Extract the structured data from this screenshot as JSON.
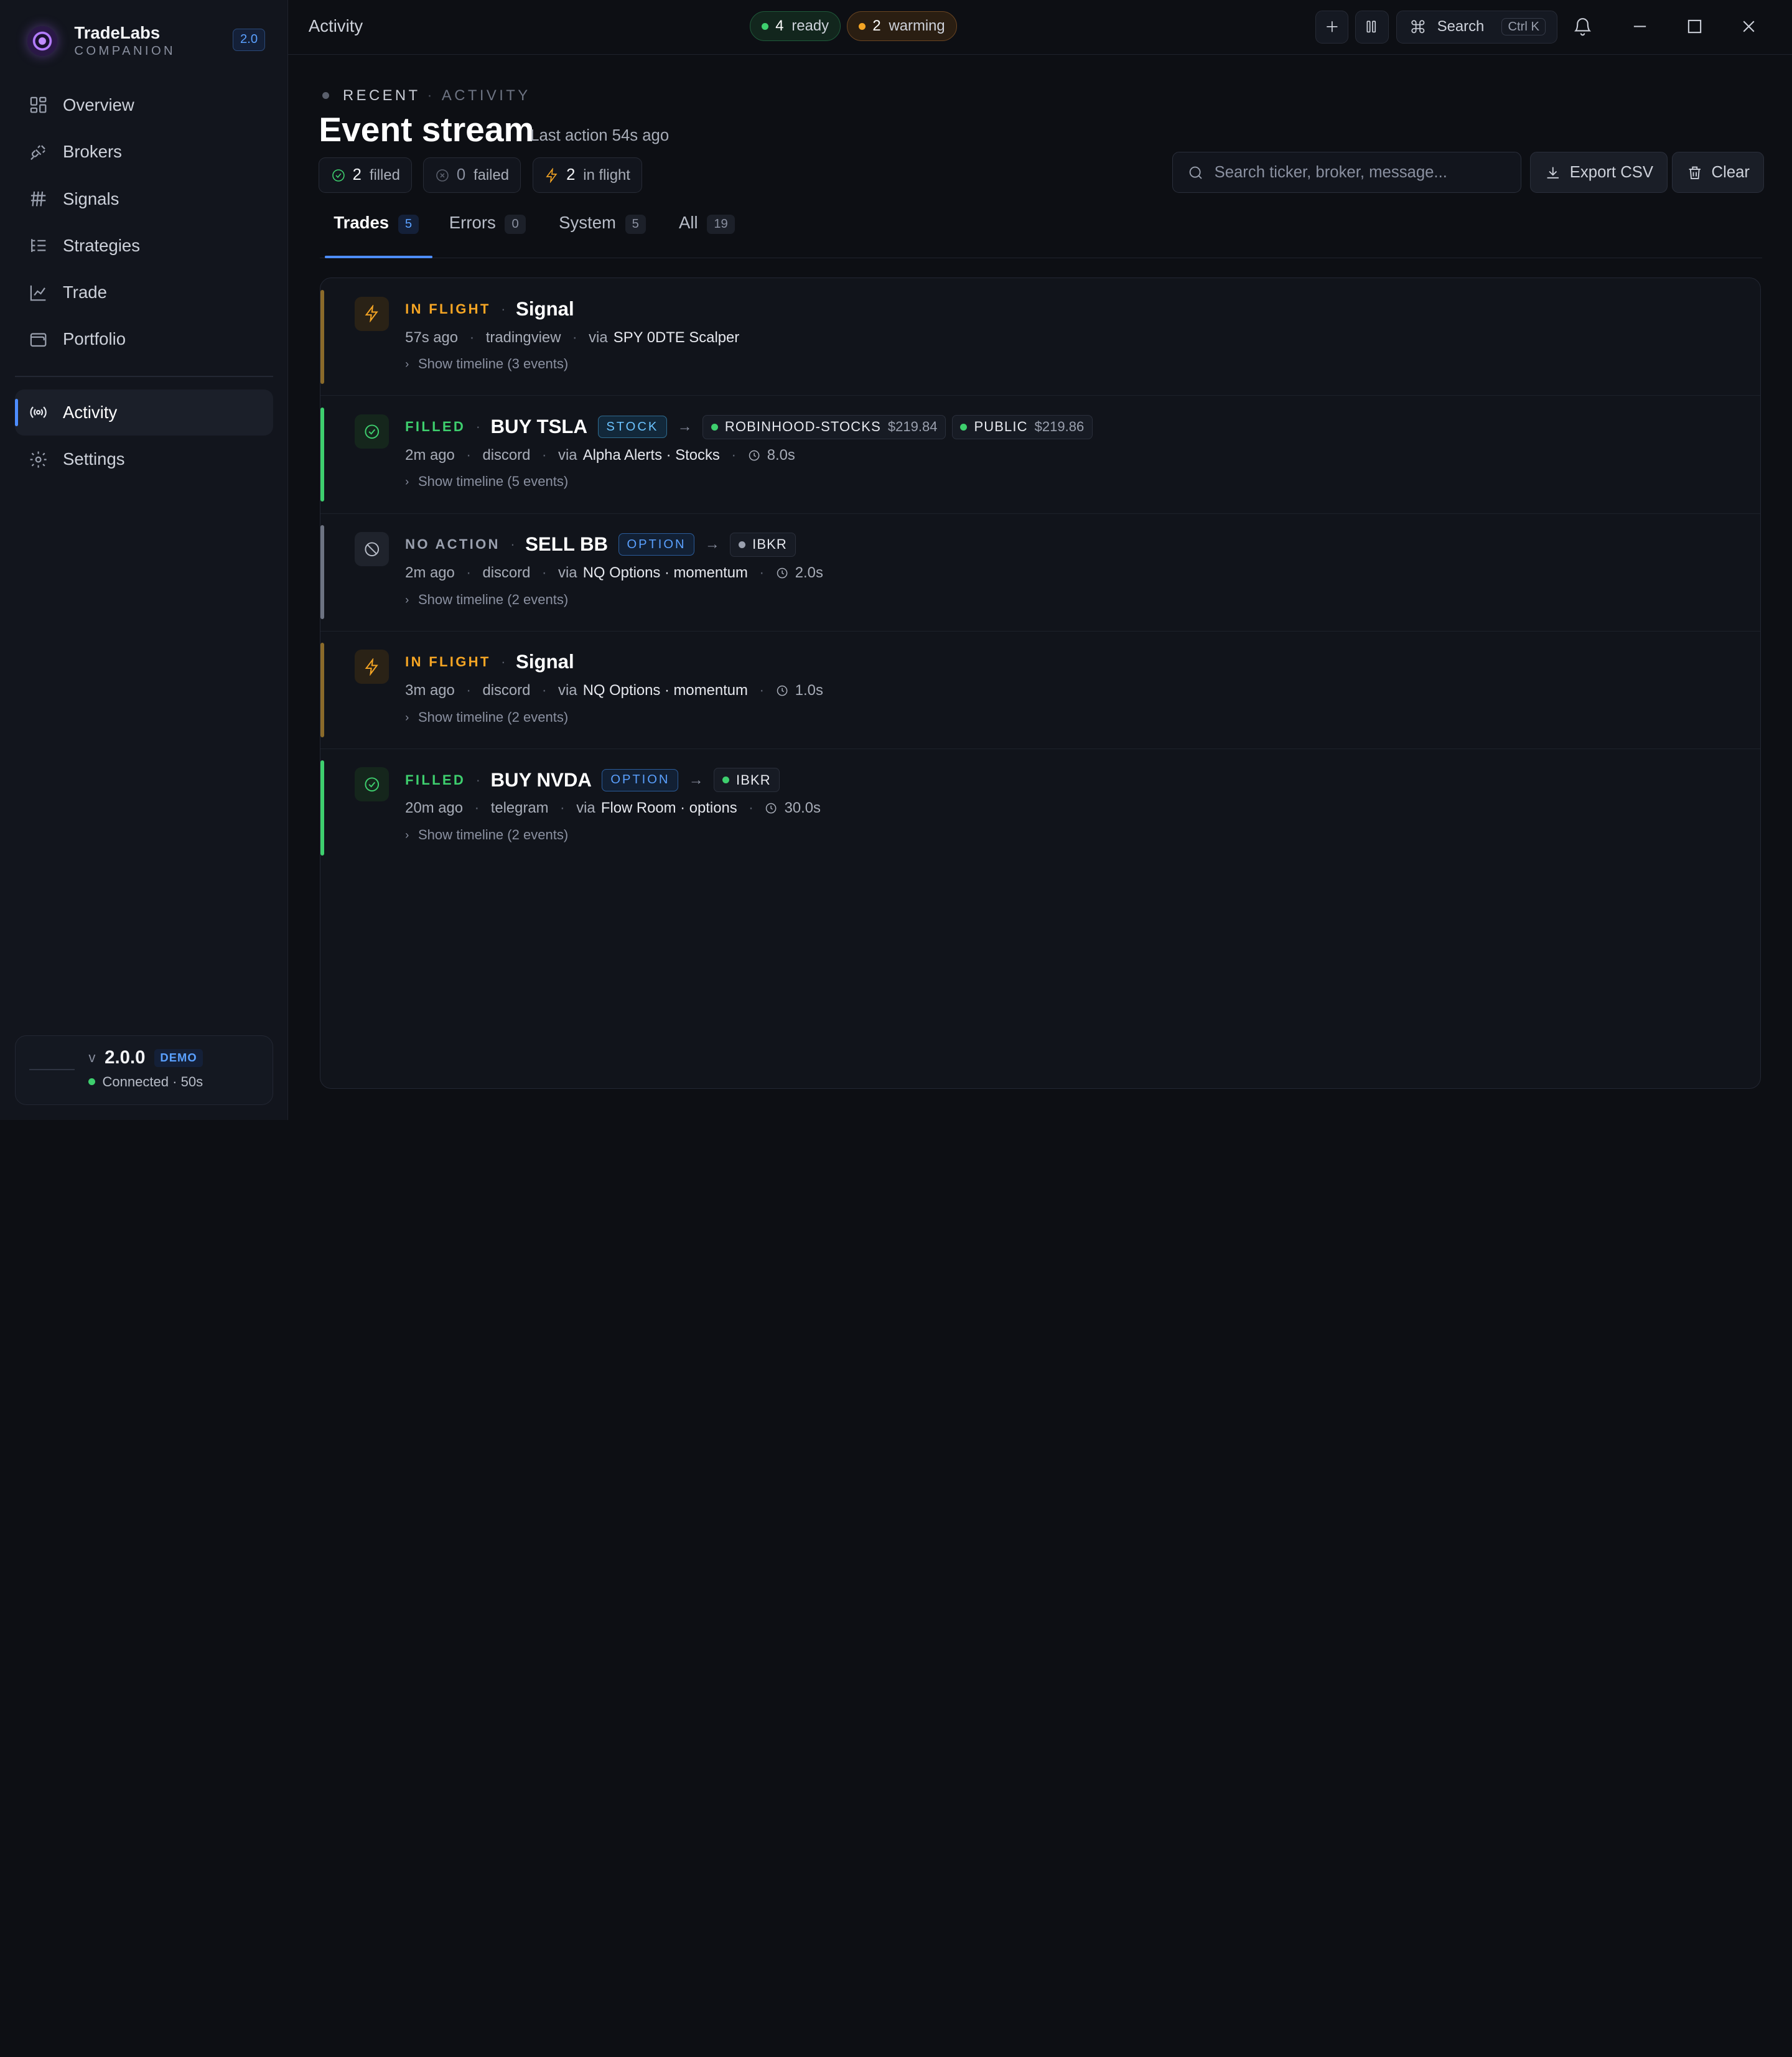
{
  "brand": {
    "name": "TradeLabs",
    "subtitle": "COMPANION",
    "version_badge": "2.0"
  },
  "nav": {
    "items": [
      {
        "label": "Overview",
        "icon": "grid-icon"
      },
      {
        "label": "Brokers",
        "icon": "plug-icon"
      },
      {
        "label": "Signals",
        "icon": "signal-icon"
      },
      {
        "label": "Strategies",
        "icon": "list-tree-icon"
      },
      {
        "label": "Trade",
        "icon": "line-chart-icon"
      },
      {
        "label": "Portfolio",
        "icon": "wallet-icon"
      }
    ],
    "bottom_items": [
      {
        "label": "Activity",
        "icon": "radio-broadcast-icon",
        "active": true
      },
      {
        "label": "Settings",
        "icon": "gear-icon"
      }
    ]
  },
  "status_card": {
    "prefix": "v",
    "version": "2.0.0",
    "badge": "DEMO",
    "connection": "Connected · 50s"
  },
  "topbar": {
    "title": "Activity",
    "ready_count": "4",
    "ready_label": "ready",
    "warming_count": "2",
    "warming_label": "warming",
    "search_label": "Search",
    "search_shortcut": "Ctrl K"
  },
  "header": {
    "crumb_primary": "RECENT",
    "crumb_secondary": "ACTIVITY",
    "title": "Event stream",
    "last_action": "Last action 54s ago"
  },
  "summary": {
    "filled_count": "2",
    "filled_label": "filled",
    "failed_count": "0",
    "failed_label": "failed",
    "inflight_count": "2",
    "inflight_label": "in flight"
  },
  "search": {
    "placeholder": "Search ticker, broker, message..."
  },
  "actions": {
    "export_label": "Export CSV",
    "clear_label": "Clear"
  },
  "tabs": [
    {
      "label": "Trades",
      "count": "5",
      "active": true
    },
    {
      "label": "Errors",
      "count": "0"
    },
    {
      "label": "System",
      "count": "5"
    },
    {
      "label": "All",
      "count": "19"
    }
  ],
  "colors": {
    "filled": "#3ecf6e",
    "in_flight": "#f5a524",
    "no_action": "#9aa0ae",
    "accent": "#4d8dff"
  },
  "events": [
    {
      "status": "IN FLIGHT",
      "status_key": "in_flight",
      "title": "Signal",
      "time": "57s ago",
      "source": "tradingview",
      "via_prefix": "via",
      "via": "SPY 0DTE Scalper",
      "timeline": "Show timeline (3 events)"
    },
    {
      "status": "FILLED",
      "status_key": "filled",
      "title": "BUY TSLA",
      "tag": "STOCK",
      "brokers": [
        {
          "name": "ROBINHOOD-STOCKS",
          "price": "$219.84",
          "dot": "green"
        },
        {
          "name": "PUBLIC",
          "price": "$219.86",
          "dot": "green"
        }
      ],
      "time": "2m ago",
      "source": "discord",
      "via_prefix": "via",
      "via": "Alpha Alerts · Stocks",
      "duration": "8.0s",
      "timeline": "Show timeline (5 events)"
    },
    {
      "status": "NO ACTION",
      "status_key": "no_action",
      "title": "SELL BB",
      "tag": "OPTION",
      "brokers": [
        {
          "name": "IBKR",
          "dot": "grey"
        }
      ],
      "time": "2m ago",
      "source": "discord",
      "via_prefix": "via",
      "via": "NQ Options · momentum",
      "duration": "2.0s",
      "timeline": "Show timeline (2 events)"
    },
    {
      "status": "IN FLIGHT",
      "status_key": "in_flight",
      "title": "Signal",
      "time": "3m ago",
      "source": "discord",
      "via_prefix": "via",
      "via": "NQ Options · momentum",
      "duration": "1.0s",
      "timeline": "Show timeline (2 events)"
    },
    {
      "status": "FILLED",
      "status_key": "filled",
      "title": "BUY NVDA",
      "tag": "OPTION",
      "brokers": [
        {
          "name": "IBKR",
          "dot": "green"
        }
      ],
      "time": "20m ago",
      "source": "telegram",
      "via_prefix": "via",
      "via": "Flow Room · options",
      "duration": "30.0s",
      "timeline": "Show timeline (2 events)"
    }
  ]
}
